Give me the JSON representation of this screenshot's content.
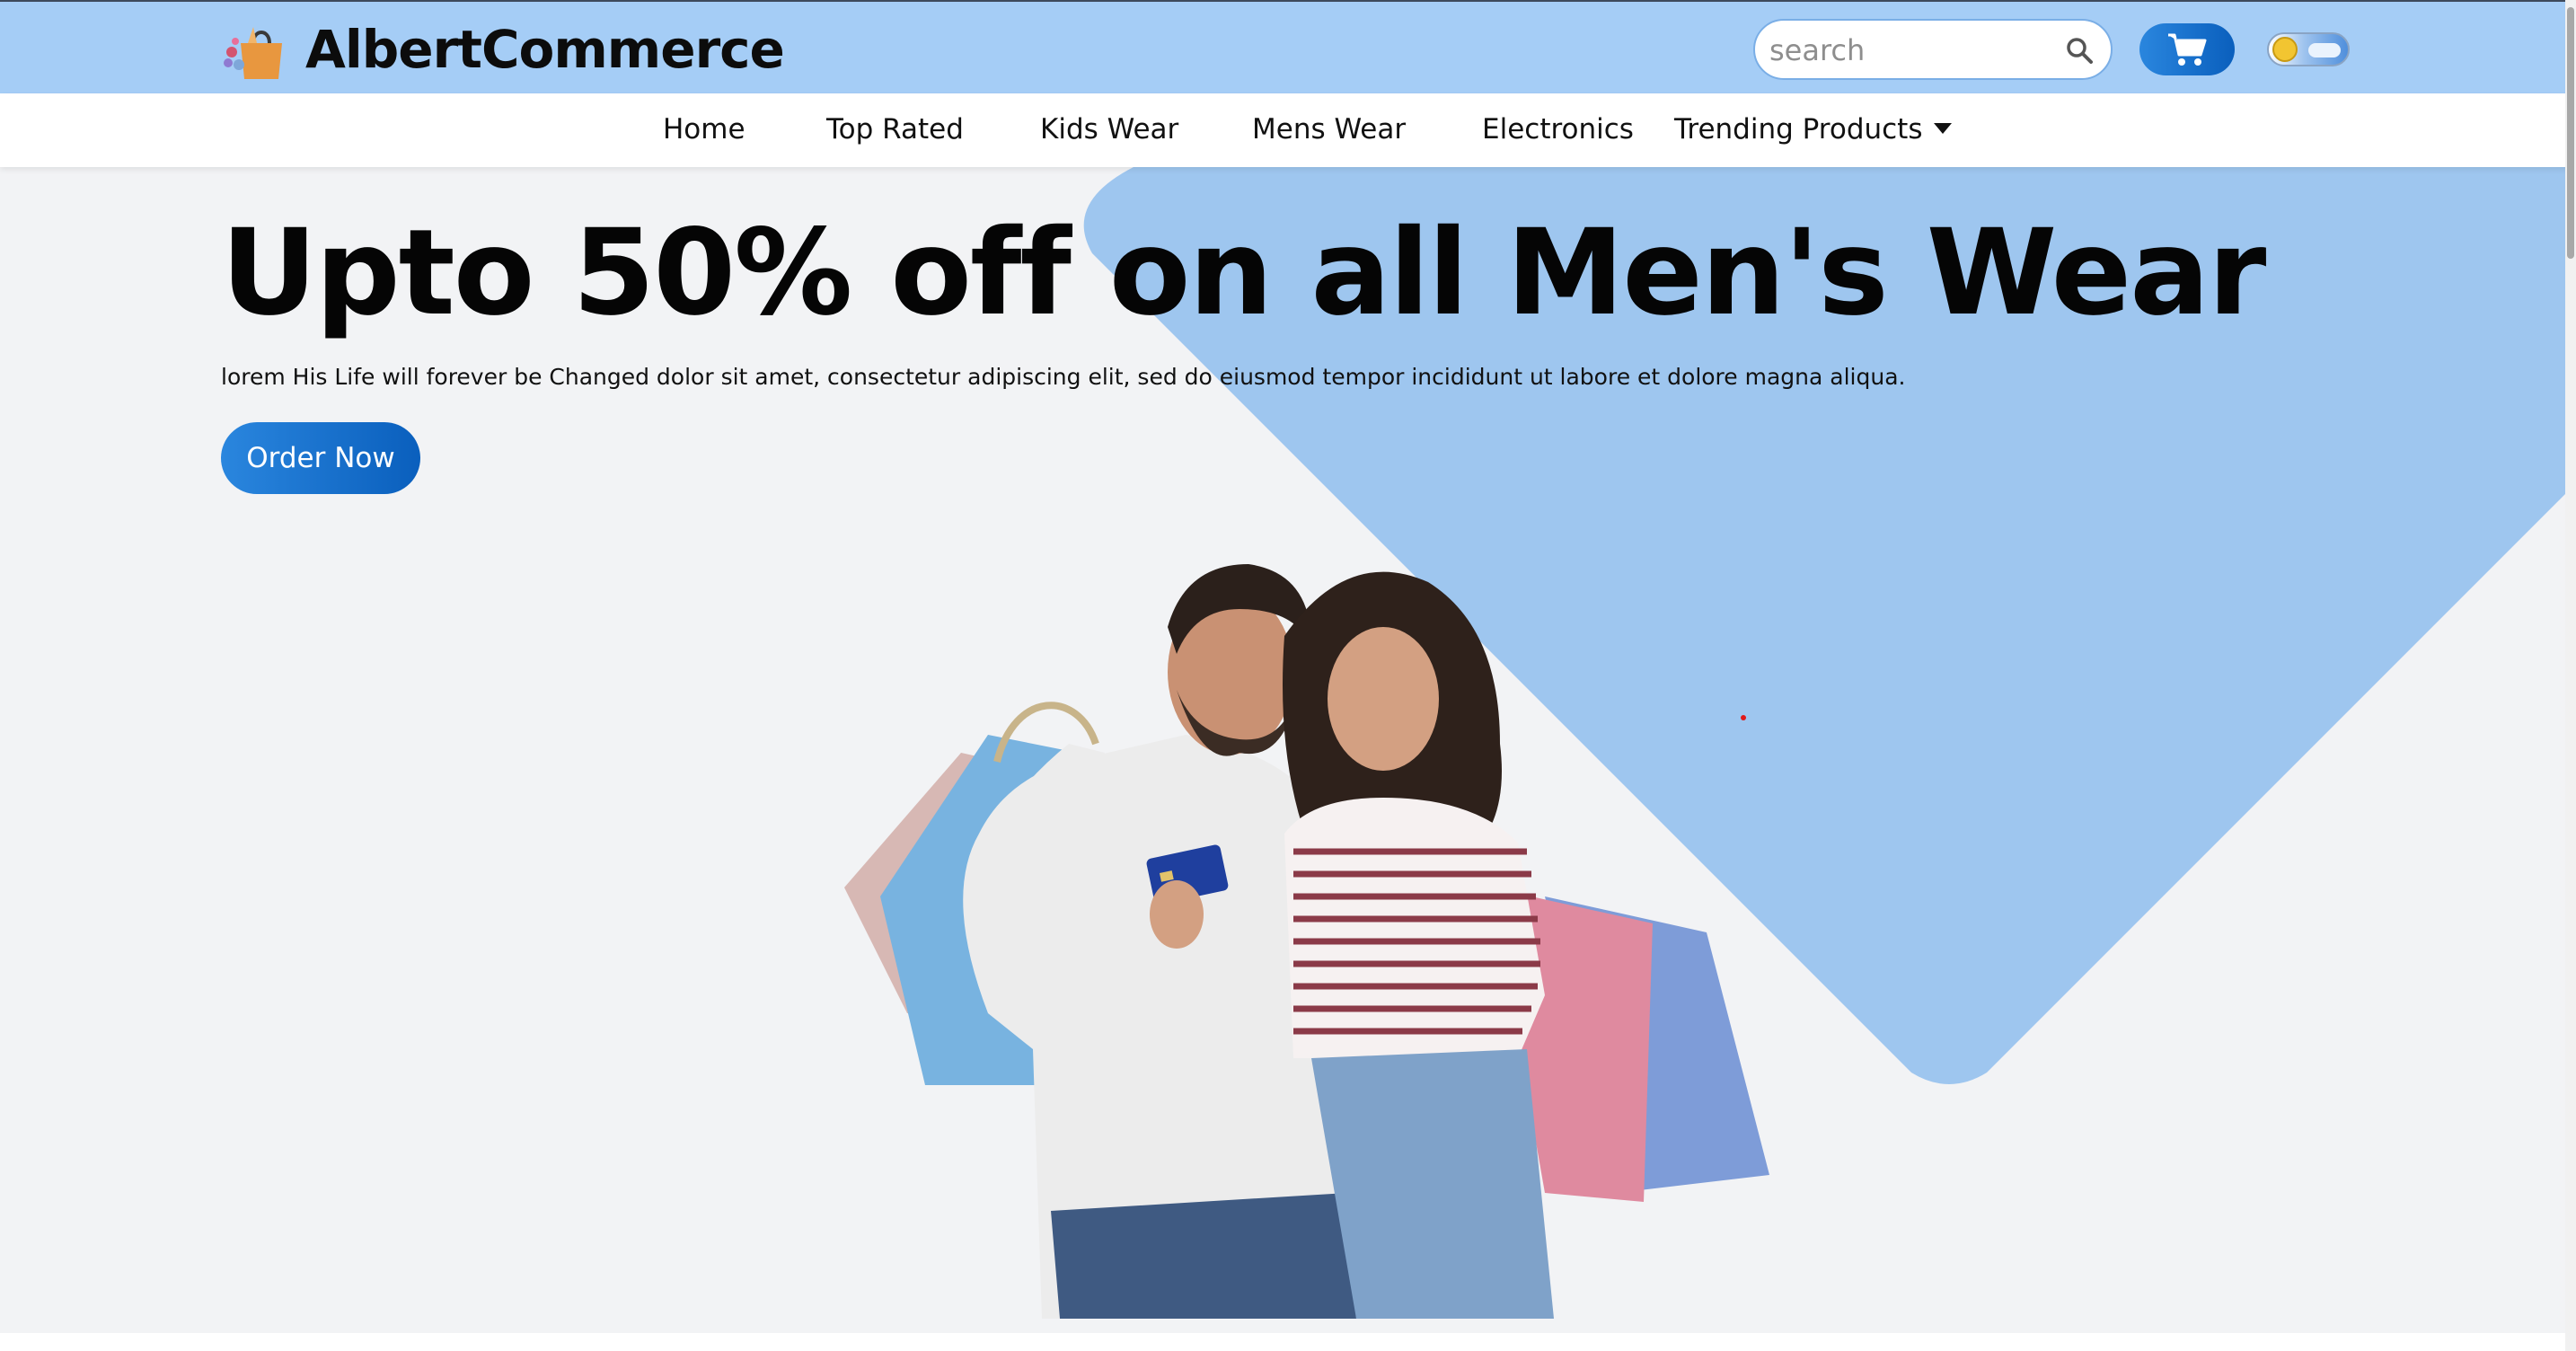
{
  "header": {
    "brand": "AlbertCommerce",
    "logo_icon": "shopping-bag-icon",
    "search": {
      "placeholder": "search",
      "value": "",
      "icon": "search-icon"
    },
    "cart_icon": "cart-icon",
    "theme_toggle": {
      "icon": "sun-icon",
      "state": "light"
    }
  },
  "nav": {
    "items": [
      {
        "label": "Home"
      },
      {
        "label": "Top Rated"
      },
      {
        "label": "Kids Wear"
      },
      {
        "label": "Mens Wear"
      },
      {
        "label": "Electronics"
      },
      {
        "label": "Trending Products",
        "icon": "caret-down-icon"
      }
    ]
  },
  "hero": {
    "title": "Upto 50% off on all Men's Wear",
    "subtitle": "lorem His Life will forever be Changed dolor sit amet, consectetur adipiscing elit, sed do eiusmod tempor incididunt ut labore et dolore magna aliqua.",
    "cta_label": "Order Now"
  },
  "colors": {
    "header_bg": "#a5cdf6",
    "hero_shape": "#9ec6ef",
    "hero_bg": "#f2f3f5",
    "button_gradient_start": "#2a86de",
    "button_gradient_end": "#0a5fbd"
  }
}
